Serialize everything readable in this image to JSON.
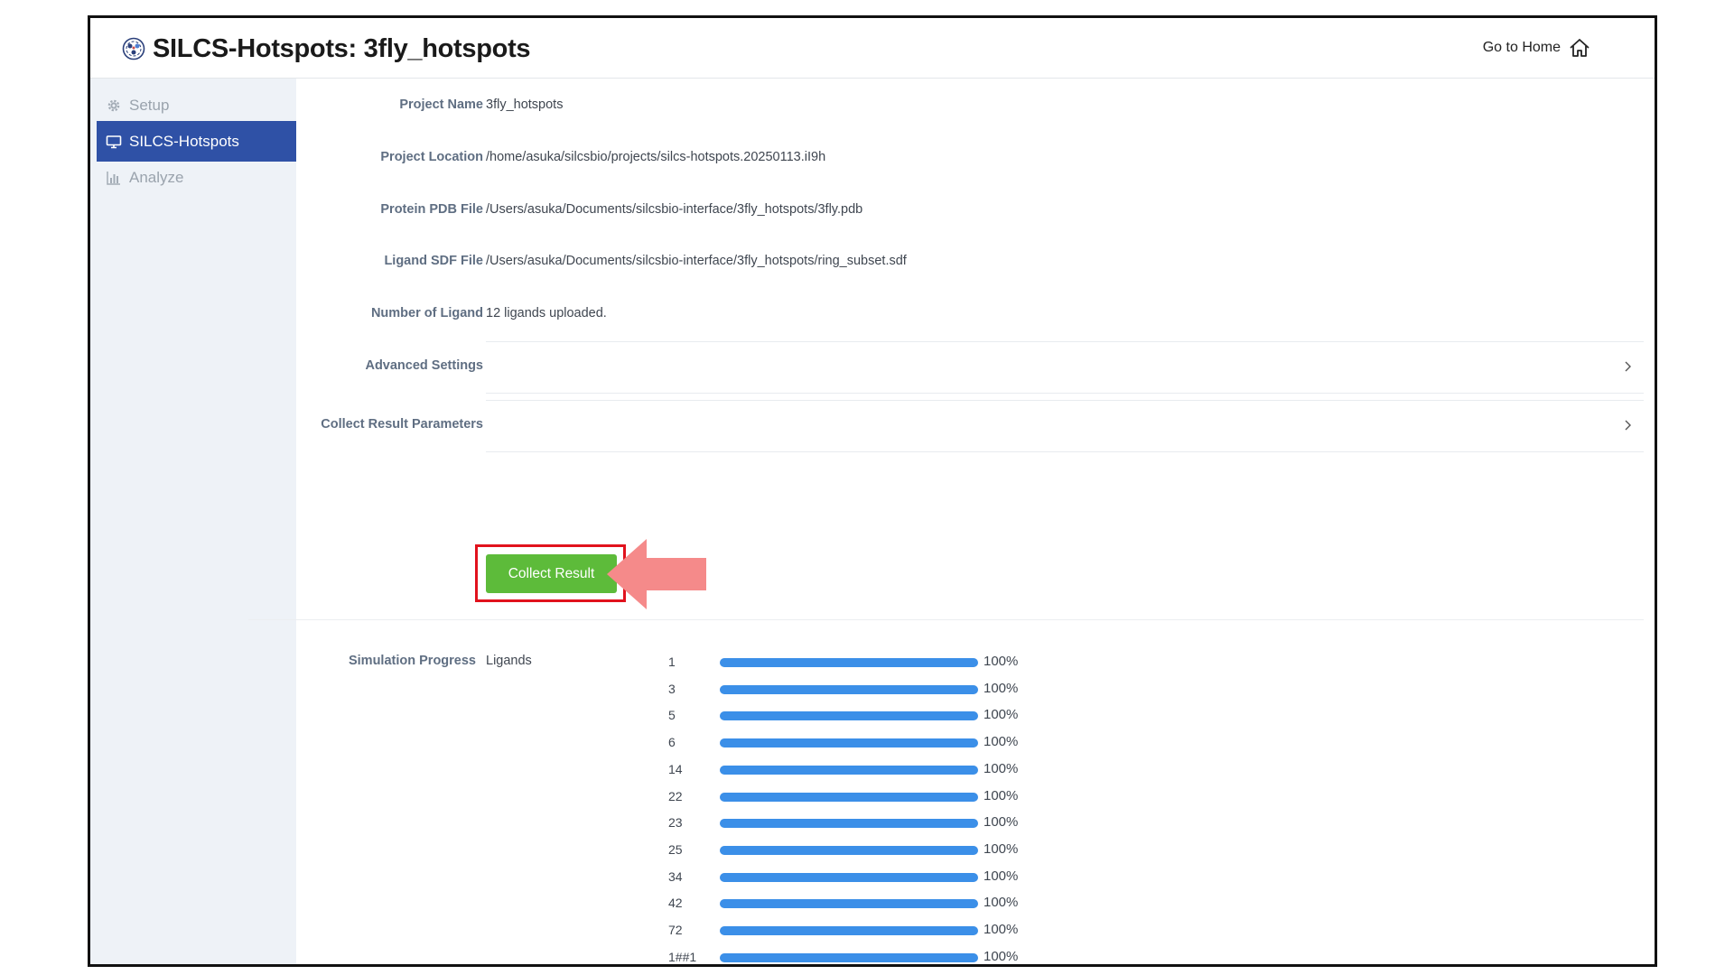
{
  "app": {
    "title": "SILCS-Hotspots: 3fly_hotspots",
    "go_home_label": "Go to Home"
  },
  "sidebar": {
    "items": [
      {
        "label": "Setup",
        "icon": "gear-icon",
        "active": false
      },
      {
        "label": "SILCS-Hotspots",
        "icon": "monitor-icon",
        "active": true
      },
      {
        "label": "Analyze",
        "icon": "bar-chart-icon",
        "active": false
      }
    ]
  },
  "fields": {
    "project_name": {
      "label": "Project Name",
      "value": "3fly_hotspots"
    },
    "project_location": {
      "label": "Project Location",
      "value": "/home/asuka/silcsbio/projects/silcs-hotspots.20250113.iI9h"
    },
    "protein_pdb": {
      "label": "Protein PDB File",
      "value": "/Users/asuka/Documents/silcsbio-interface/3fly_hotspots/3fly.pdb"
    },
    "ligand_sdf": {
      "label": "Ligand SDF File",
      "value": "/Users/asuka/Documents/silcsbio-interface/3fly_hotspots/ring_subset.sdf"
    },
    "num_ligand": {
      "label": "Number of Ligand",
      "value": "12 ligands uploaded."
    }
  },
  "sections": {
    "advanced_settings": "Advanced Settings",
    "collect_result_parameters": "Collect Result Parameters"
  },
  "collect_button_label": "Collect Result",
  "progress": {
    "label": "Simulation Progress",
    "column_label": "Ligands",
    "items": [
      {
        "id": "1",
        "pct": 100,
        "pct_label": "100%"
      },
      {
        "id": "3",
        "pct": 100,
        "pct_label": "100%"
      },
      {
        "id": "5",
        "pct": 100,
        "pct_label": "100%"
      },
      {
        "id": "6",
        "pct": 100,
        "pct_label": "100%"
      },
      {
        "id": "14",
        "pct": 100,
        "pct_label": "100%"
      },
      {
        "id": "22",
        "pct": 100,
        "pct_label": "100%"
      },
      {
        "id": "23",
        "pct": 100,
        "pct_label": "100%"
      },
      {
        "id": "25",
        "pct": 100,
        "pct_label": "100%"
      },
      {
        "id": "34",
        "pct": 100,
        "pct_label": "100%"
      },
      {
        "id": "42",
        "pct": 100,
        "pct_label": "100%"
      },
      {
        "id": "72",
        "pct": 100,
        "pct_label": "100%"
      },
      {
        "id": "1##1",
        "pct": 100,
        "pct_label": "100%"
      }
    ]
  },
  "colors": {
    "sidebar_active": "#2f51a6",
    "button_green": "#5dbb3a",
    "progress_blue": "#3b8fe8",
    "highlight_red": "#e1121d",
    "arrow_pink": "#f58a8a"
  }
}
